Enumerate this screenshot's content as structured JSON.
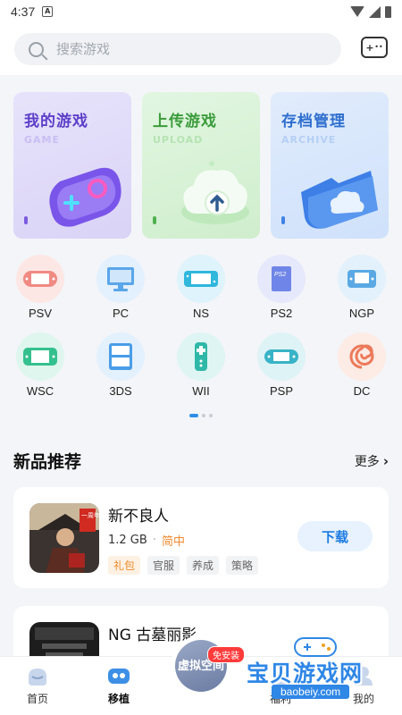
{
  "status_bar": {
    "time": "4:37",
    "notification": "A"
  },
  "search": {
    "placeholder": "搜索游戏",
    "icon": "search-icon"
  },
  "header": {
    "right_icon": "gamepad-icon"
  },
  "feature_cards": [
    {
      "title": "我的游戏",
      "subtitle": "GAME",
      "icon": "gamepad-illustration"
    },
    {
      "title": "上传游戏",
      "subtitle": "UPLOAD",
      "icon": "upload-cloud-illustration"
    },
    {
      "title": "存档管理",
      "subtitle": "ARCHIVE",
      "icon": "folder-cloud-illustration"
    }
  ],
  "platforms": [
    {
      "label": "PSV",
      "color": "#fde7e5",
      "icon": "psv-icon"
    },
    {
      "label": "PC",
      "color": "#e3f0fd",
      "icon": "monitor-icon"
    },
    {
      "label": "NS",
      "color": "#def3fb",
      "icon": "switch-icon"
    },
    {
      "label": "PS2",
      "color": "#e6e9fb",
      "icon": "ps2-icon"
    },
    {
      "label": "NGP",
      "color": "#e2f1fb",
      "icon": "ngp-icon"
    },
    {
      "label": "WSC",
      "color": "#dff6ee",
      "icon": "wsc-icon"
    },
    {
      "label": "3DS",
      "color": "#e3f0fd",
      "icon": "3ds-icon"
    },
    {
      "label": "WII",
      "color": "#def5f3",
      "icon": "wii-remote-icon"
    },
    {
      "label": "PSP",
      "color": "#def3f6",
      "icon": "psp-icon"
    },
    {
      "label": "DC",
      "color": "#fdebe5",
      "icon": "dreamcast-icon"
    }
  ],
  "section": {
    "title": "新品推荐",
    "more": "更多"
  },
  "games": [
    {
      "name": "新不良人",
      "size": "1.2 GB",
      "lang": "简中",
      "tags": [
        "礼包",
        "官服",
        "养成",
        "策略"
      ],
      "button": "下载",
      "thumb_text": "一周年"
    },
    {
      "name": "NG 古墓丽影",
      "size": "",
      "lang": "",
      "tags": [],
      "button": ""
    }
  ],
  "bottom_nav": {
    "items": [
      {
        "label": "首页",
        "icon": "home-icon"
      },
      {
        "label": "移植",
        "icon": "port-icon",
        "active": true
      },
      {
        "label": "福利",
        "icon": "gift-icon"
      },
      {
        "label": "我的",
        "icon": "profile-icon"
      }
    ],
    "center_label": "虚拟空间",
    "center_badge": "免安装"
  },
  "watermark": {
    "text": "宝贝游戏网",
    "url": "baobeiy.com"
  }
}
